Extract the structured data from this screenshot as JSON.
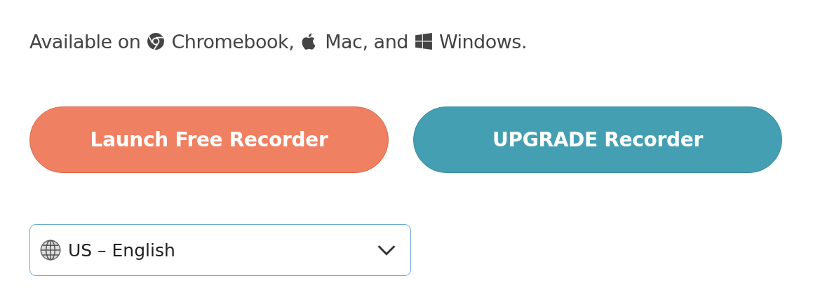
{
  "availability": {
    "intro": "Available on",
    "platforms": [
      {
        "label": "Chromebook,"
      },
      {
        "label": "Mac, and"
      },
      {
        "label": "Windows."
      }
    ]
  },
  "buttons": [
    {
      "label": "Launch Free Recorder",
      "kind": "primary"
    },
    {
      "label": "UPGRADE Recorder",
      "kind": "upgrade"
    }
  ],
  "language_select": {
    "value": "US – English"
  }
}
